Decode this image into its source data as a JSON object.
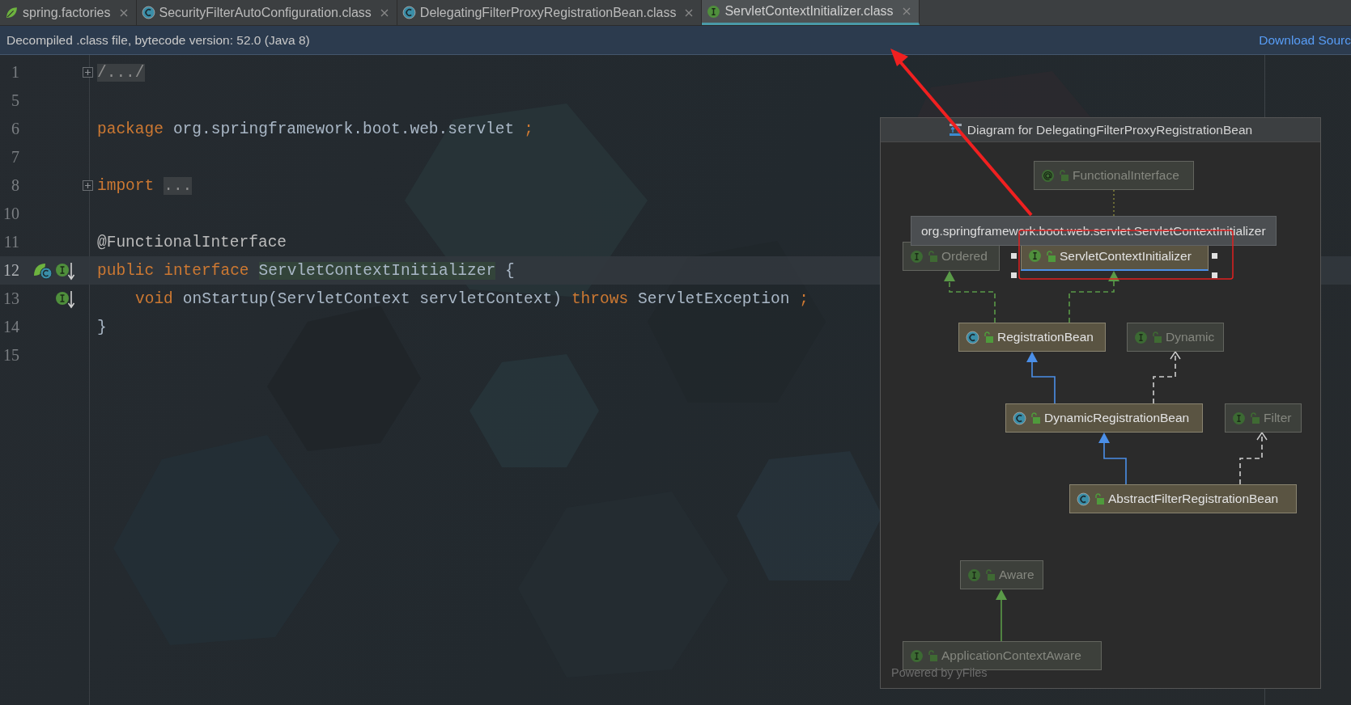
{
  "tabs": [
    {
      "label": "spring.factories",
      "kind": "spring",
      "selected": false
    },
    {
      "label": "SecurityFilterAutoConfiguration.class",
      "kind": "class",
      "selected": false
    },
    {
      "label": "DelegatingFilterProxyRegistrationBean.class",
      "kind": "class",
      "selected": false
    },
    {
      "label": "ServletContextInitializer.class",
      "kind": "interface",
      "selected": true
    }
  ],
  "notification": {
    "message": "Decompiled .class file, bytecode version: 52.0 (Java 8)",
    "link": "Download Sourc"
  },
  "editor": {
    "lines": [
      {
        "number": "1",
        "folded": true,
        "current": false,
        "indent": false,
        "tokens": [
          {
            "kind": "fold",
            "text": "/.../"
          }
        ]
      },
      {
        "number": "5",
        "folded": false,
        "current": false
      },
      {
        "number": "6",
        "folded": false,
        "current": false,
        "indent": false,
        "tokens": [
          {
            "kind": "keyword",
            "text": "package"
          },
          {
            "kind": "plain",
            "text": "org.springframework.boot.web.servlet"
          },
          {
            "kind": "punct",
            "text": ";"
          }
        ]
      },
      {
        "number": "7",
        "folded": false,
        "current": false
      },
      {
        "number": "8",
        "folded": true,
        "current": false,
        "indent": false,
        "tokens": [
          {
            "kind": "keyword",
            "text": "import"
          },
          {
            "kind": "fold",
            "text": "..."
          }
        ]
      },
      {
        "number": "10",
        "folded": false,
        "current": false
      },
      {
        "number": "11",
        "folded": false,
        "current": false,
        "indent": false,
        "tokens": [
          {
            "kind": "annotation",
            "text": "@FunctionalInterface"
          }
        ]
      },
      {
        "number": "12",
        "folded": false,
        "current": true,
        "indent": false,
        "gutter": [
          {
            "kind": "bean"
          },
          {
            "kind": "implemented"
          }
        ],
        "tokens": [
          {
            "kind": "keyword",
            "text": "public"
          },
          {
            "kind": "keyword",
            "text": "interface"
          },
          {
            "kind": "highlight",
            "text": "ServletContextInitializer"
          },
          {
            "kind": "plain",
            "text": "{"
          }
        ]
      },
      {
        "number": "13",
        "folded": false,
        "current": false,
        "indent": true,
        "gutter": [
          {
            "kind": "implemented"
          }
        ],
        "tokens": [
          {
            "kind": "keyword",
            "text": "void"
          },
          {
            "kind": "plain",
            "text": "onStartup(ServletContext servletContext)"
          },
          {
            "kind": "keyword",
            "text": "throws"
          },
          {
            "kind": "plain",
            "text": "ServletException"
          },
          {
            "kind": "punct",
            "text": ";"
          }
        ]
      },
      {
        "number": "14",
        "folded": false,
        "current": false,
        "indent": false,
        "tokens": [
          {
            "kind": "plain",
            "text": "}"
          }
        ]
      },
      {
        "number": "15",
        "folded": false,
        "current": false
      }
    ]
  },
  "diagram": {
    "title": "Diagram for DelegatingFilterProxyRegistrationBean",
    "nodes": [
      {
        "name": "FunctionalInterface",
        "kind": "annotation",
        "dimmed": true,
        "selected": false
      },
      {
        "name": "Ordered",
        "kind": "interface",
        "dimmed": true,
        "selected": false
      },
      {
        "name": "ServletContextInitializer",
        "kind": "interface",
        "dimmed": false,
        "selected": true
      },
      {
        "name": "RegistrationBean",
        "kind": "class",
        "dimmed": false,
        "selected": false
      },
      {
        "name": "Dynamic",
        "kind": "interface",
        "dimmed": true,
        "selected": false
      },
      {
        "name": "DynamicRegistrationBean",
        "kind": "class",
        "dimmed": false,
        "selected": false
      },
      {
        "name": "Filter",
        "kind": "interface",
        "dimmed": true,
        "selected": false
      },
      {
        "name": "AbstractFilterRegistrationBean",
        "kind": "class",
        "dimmed": false,
        "selected": false
      },
      {
        "name": "Aware",
        "kind": "interface",
        "dimmed": true,
        "selected": false
      },
      {
        "name": "ApplicationContextAware",
        "kind": "interface",
        "dimmed": true,
        "selected": false
      }
    ],
    "edges": [
      {
        "kind": "annotated"
      },
      {
        "kind": "realizes"
      },
      {
        "kind": "realizes"
      },
      {
        "kind": "extends"
      },
      {
        "kind": "dependency"
      },
      {
        "kind": "extends"
      },
      {
        "kind": "dependency"
      },
      {
        "kind": "interface-extends"
      }
    ],
    "tooltip": "org.springframework.boot.web.servlet.ServletContextInitializer",
    "footer": "Powered by yFiles"
  }
}
